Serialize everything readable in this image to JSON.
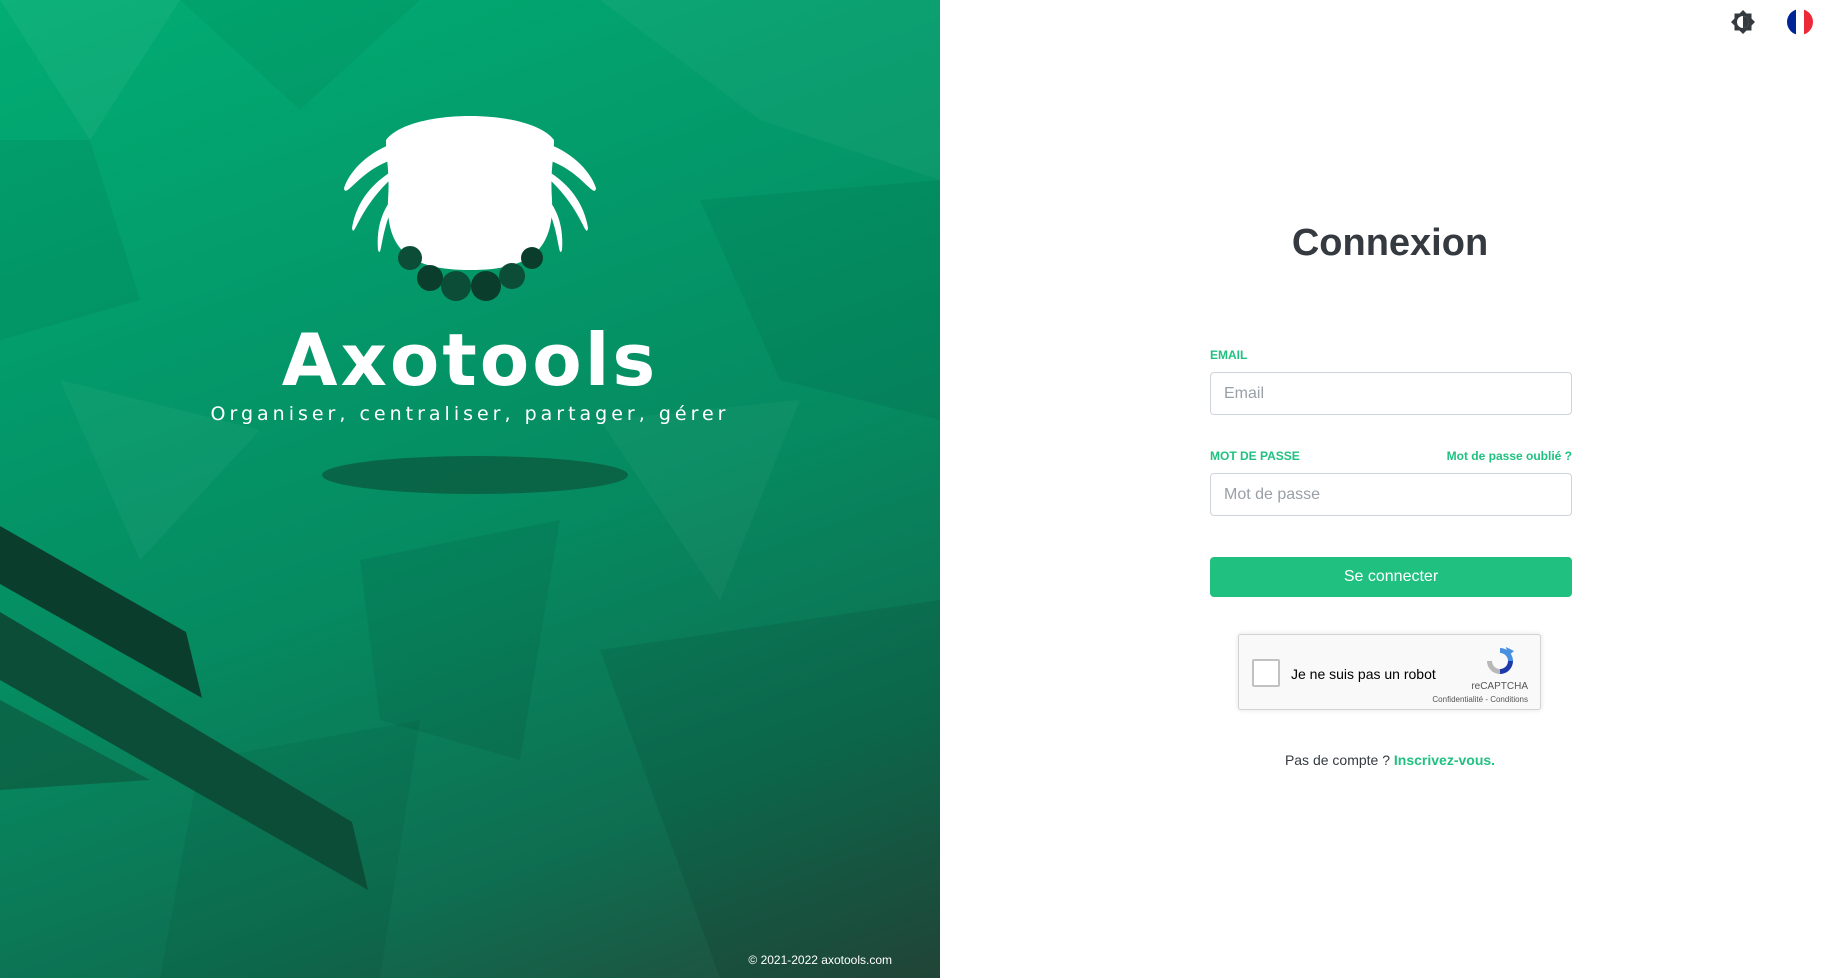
{
  "brand": {
    "name": "Axotools",
    "tagline": "Organiser, centraliser, partager, gérer",
    "copyright": "© 2021-2022 axotools.com",
    "colors": {
      "accent": "#20c180",
      "panel_top": "#02ad73",
      "panel_bottom": "#244a3c"
    }
  },
  "header": {
    "theme_icon": "brightness-icon",
    "language_flag": "french-flag-icon",
    "flag_colors": [
      "#002395",
      "#ffffff",
      "#ed2939"
    ]
  },
  "login": {
    "title": "Connexion",
    "email_label": "EMAIL",
    "email_placeholder": "Email",
    "email_value": "",
    "password_label": "MOT DE PASSE",
    "password_placeholder": "Mot de passe",
    "password_value": "",
    "forgot_link": "Mot de passe oublié ?",
    "submit_label": "Se connecter"
  },
  "captcha": {
    "label": "Je ne suis pas un robot",
    "brand": "reCAPTCHA",
    "links": "Confidentialité - Conditions",
    "checked": false
  },
  "signup": {
    "prompt": "Pas de compte ?",
    "link": "Inscrivez-vous."
  }
}
